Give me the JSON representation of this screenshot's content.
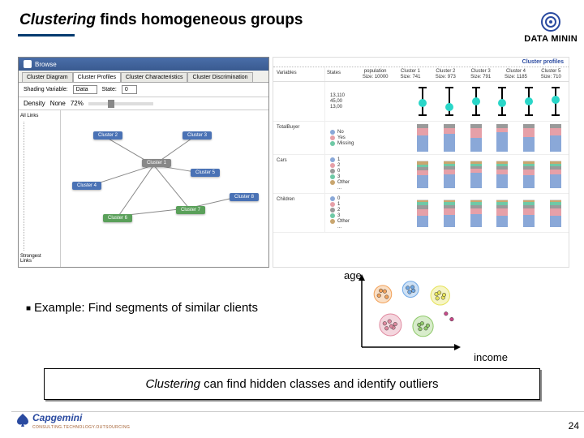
{
  "title": {
    "italic": "Clustering",
    "rest": " finds homogeneous groups"
  },
  "brand": "DATA MININ",
  "app": {
    "window_title": "Browse",
    "tabs": [
      "Cluster Diagram",
      "Cluster Profiles",
      "Cluster Characteristics",
      "Cluster Discrimination"
    ],
    "active_tab": 1,
    "shading_label": "Shading Variable:",
    "shading_value": "Data",
    "state_label": "State:",
    "state_value": "0",
    "density_label": "Density",
    "density_value": "None",
    "density_accent": "72%",
    "side_top": "All Links",
    "side_bottom": "Strongest\nLinks",
    "nodes": [
      "Cluster 1",
      "Cluster 2",
      "Cluster 3",
      "Cluster 4",
      "Cluster 5",
      "Cluster 6",
      "Cluster 7",
      "Cluster 8"
    ]
  },
  "profiles": {
    "header": "Cluster profiles",
    "var_label": "Variables",
    "status_label": "States",
    "cluster_headers": [
      {
        "l1": "population",
        "l2": "Size: 10000"
      },
      {
        "l1": "Cluster 1",
        "l2": "Size: 741"
      },
      {
        "l1": "Cluster 2",
        "l2": "Size: 973"
      },
      {
        "l1": "Cluster 3",
        "l2": "Size: 791"
      },
      {
        "l1": "Cluster 4",
        "l2": "Size: 1185"
      },
      {
        "l1": "Cluster 5",
        "l2": "Size: 710"
      }
    ],
    "rows": [
      {
        "var": "",
        "legend": [
          "13,110",
          "45,00",
          "13,00"
        ],
        "kind": "box",
        "medians": [
          0.45,
          0.3,
          0.5,
          0.45,
          0.5,
          0.55
        ],
        "colors": [
          "#2ad6c8",
          "#2ad6c8",
          "#2ad6c8",
          "#2ad6c8",
          "#2ad6c8",
          "#2ad6c8"
        ]
      },
      {
        "var": "TotalBuyer",
        "legend": [
          {
            "c": "#8aa8d8",
            "t": "No"
          },
          {
            "c": "#e6a0a8",
            "t": "Yes"
          },
          {
            "c": "#6fc9a6",
            "t": "Missing"
          }
        ],
        "kind": "stack",
        "stacks": [
          [
            60,
            25,
            15
          ],
          [
            65,
            20,
            15
          ],
          [
            50,
            35,
            15
          ],
          [
            70,
            15,
            15
          ],
          [
            55,
            30,
            15
          ],
          [
            60,
            25,
            15
          ]
        ]
      },
      {
        "var": "Cars",
        "legend": [
          {
            "c": "#8aa8d8",
            "t": "1"
          },
          {
            "c": "#e6a0a8",
            "t": "2"
          },
          {
            "c": "#9a9a9a",
            "t": "0"
          },
          {
            "c": "#6fc9a6",
            "t": "3"
          },
          {
            "c": "#c9a66f",
            "t": "Other"
          },
          {
            "c": "#ffffff",
            "t": "..."
          }
        ],
        "kind": "stack",
        "stacks": [
          [
            45,
            20,
            10,
            10,
            10,
            5
          ],
          [
            50,
            18,
            10,
            10,
            8,
            4
          ],
          [
            55,
            15,
            10,
            8,
            8,
            4
          ],
          [
            48,
            20,
            10,
            10,
            8,
            4
          ],
          [
            46,
            22,
            10,
            10,
            8,
            4
          ],
          [
            50,
            18,
            10,
            10,
            8,
            4
          ]
        ]
      },
      {
        "var": "Children",
        "legend": [
          {
            "c": "#8aa8d8",
            "t": "0"
          },
          {
            "c": "#e6a0a8",
            "t": "1"
          },
          {
            "c": "#9a9a9a",
            "t": "2"
          },
          {
            "c": "#6fc9a6",
            "t": "3"
          },
          {
            "c": "#c9a66f",
            "t": "Other"
          },
          {
            "c": "#ffffff",
            "t": "..."
          }
        ],
        "kind": "stack",
        "stacks": [
          [
            40,
            25,
            15,
            10,
            7,
            3
          ],
          [
            42,
            24,
            14,
            10,
            7,
            3
          ],
          [
            45,
            22,
            13,
            10,
            7,
            3
          ],
          [
            40,
            26,
            14,
            10,
            7,
            3
          ],
          [
            43,
            24,
            13,
            10,
            7,
            3
          ],
          [
            41,
            25,
            14,
            10,
            7,
            3
          ]
        ]
      }
    ]
  },
  "bullet": "Example: Find segments of similar clients",
  "chart_data": {
    "type": "scatter",
    "xlabel": "income",
    "ylabel": "age",
    "title": "",
    "xlim": [
      0,
      10
    ],
    "ylim": [
      0,
      10
    ],
    "clusters": [
      {
        "cx": 2.2,
        "cy": 7.6,
        "r": 1.2,
        "fill": "#f2a25a",
        "pts": [
          [
            1.8,
            7.4
          ],
          [
            2.4,
            8.0
          ],
          [
            2.6,
            7.2
          ],
          [
            2.0,
            8.1
          ]
        ]
      },
      {
        "cx": 5.1,
        "cy": 8.3,
        "r": 1.1,
        "fill": "#6fa8e6",
        "pts": [
          [
            4.8,
            8.5
          ],
          [
            5.4,
            8.1
          ],
          [
            5.0,
            7.9
          ],
          [
            5.3,
            8.6
          ]
        ]
      },
      {
        "cx": 8.2,
        "cy": 7.4,
        "r": 1.3,
        "fill": "#e6e25a",
        "pts": [
          [
            7.8,
            7.6
          ],
          [
            8.5,
            7.1
          ],
          [
            8.1,
            7.8
          ],
          [
            8.6,
            7.5
          ],
          [
            7.9,
            7.0
          ]
        ]
      },
      {
        "cx": 3.0,
        "cy": 3.2,
        "r": 1.5,
        "fill": "#e08aa0",
        "pts": [
          [
            2.4,
            3.4
          ],
          [
            3.3,
            2.8
          ],
          [
            2.9,
            3.7
          ],
          [
            3.5,
            3.3
          ],
          [
            2.6,
            2.7
          ],
          [
            3.1,
            3.0
          ]
        ]
      },
      {
        "cx": 6.4,
        "cy": 3.0,
        "r": 1.4,
        "fill": "#8fc96a",
        "pts": [
          [
            6.0,
            3.2
          ],
          [
            6.7,
            2.7
          ],
          [
            6.3,
            3.4
          ],
          [
            6.9,
            3.1
          ],
          [
            6.1,
            2.6
          ]
        ]
      }
    ],
    "outliers": [
      [
        8.8,
        4.8
      ],
      [
        9.4,
        4.0
      ]
    ]
  },
  "callout": {
    "italic": "Clustering",
    "rest": " can find hidden classes and identify outliers"
  },
  "footer_logo": "Capgemini",
  "footer_sub": "CONSULTING.TECHNOLOGY.OUTSOURCING",
  "page": "24"
}
